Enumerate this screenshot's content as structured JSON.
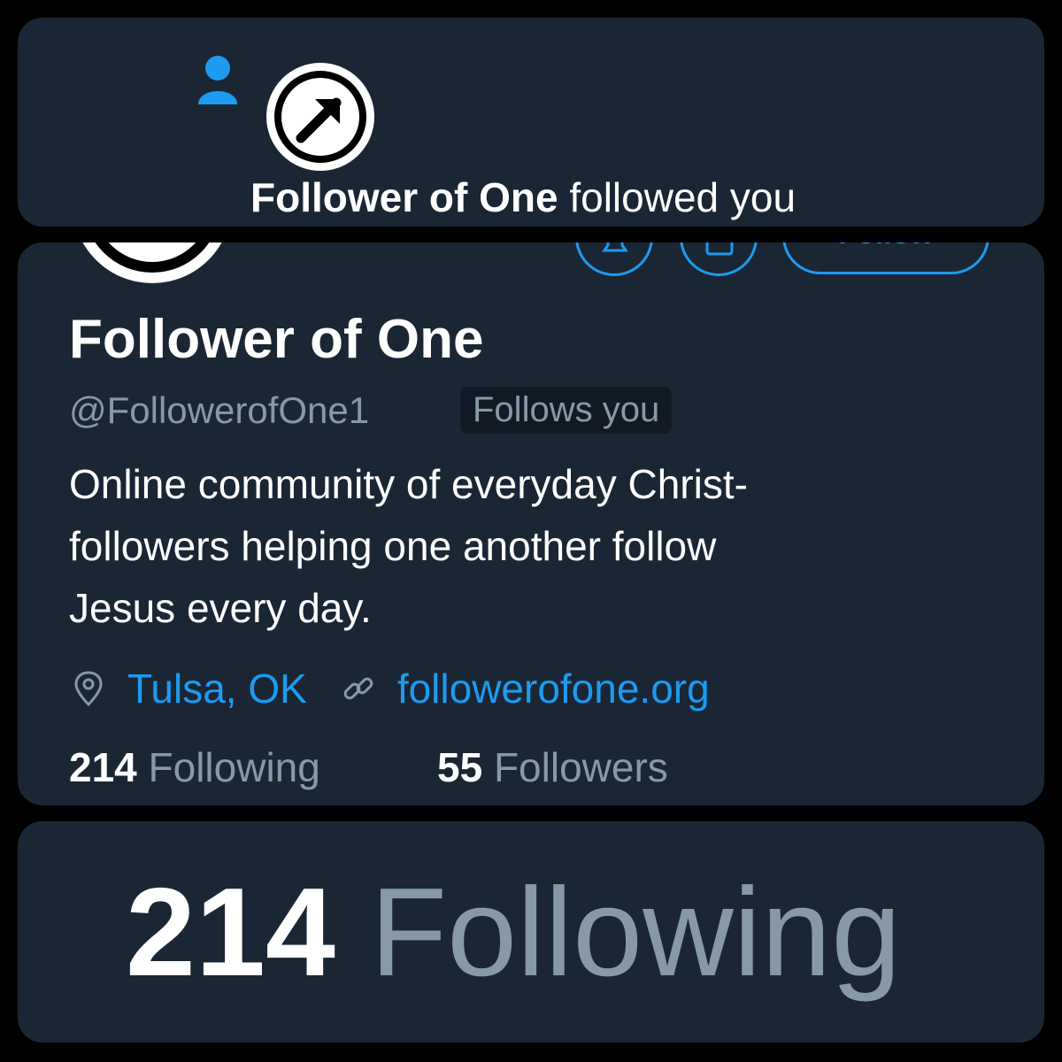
{
  "notification": {
    "actor_name": "Follower of One",
    "action_text": " followed you",
    "icon": "person-icon",
    "avatar_icon": "arrow-up-right-circle-icon"
  },
  "profile": {
    "follow_button_label": "Follow",
    "display_name": "Follower of One",
    "handle": "@FollowerofOne1",
    "follows_you_badge": "Follows you",
    "bio_lines": [
      "Online community of everyday Christ-",
      "followers helping one another follow",
      "Jesus every day."
    ],
    "location": "Tulsa, OK",
    "website": "followerofone.org",
    "following_count": "214",
    "following_label": " Following",
    "followers_count": "55",
    "followers_label": " Followers"
  },
  "zoom": {
    "following_count": "214",
    "following_label": " Following"
  },
  "colors": {
    "background": "#000000",
    "panel": "#1b2634",
    "accent": "#1d9bf0",
    "muted_text": "#8899a6",
    "text": "#ffffff"
  }
}
